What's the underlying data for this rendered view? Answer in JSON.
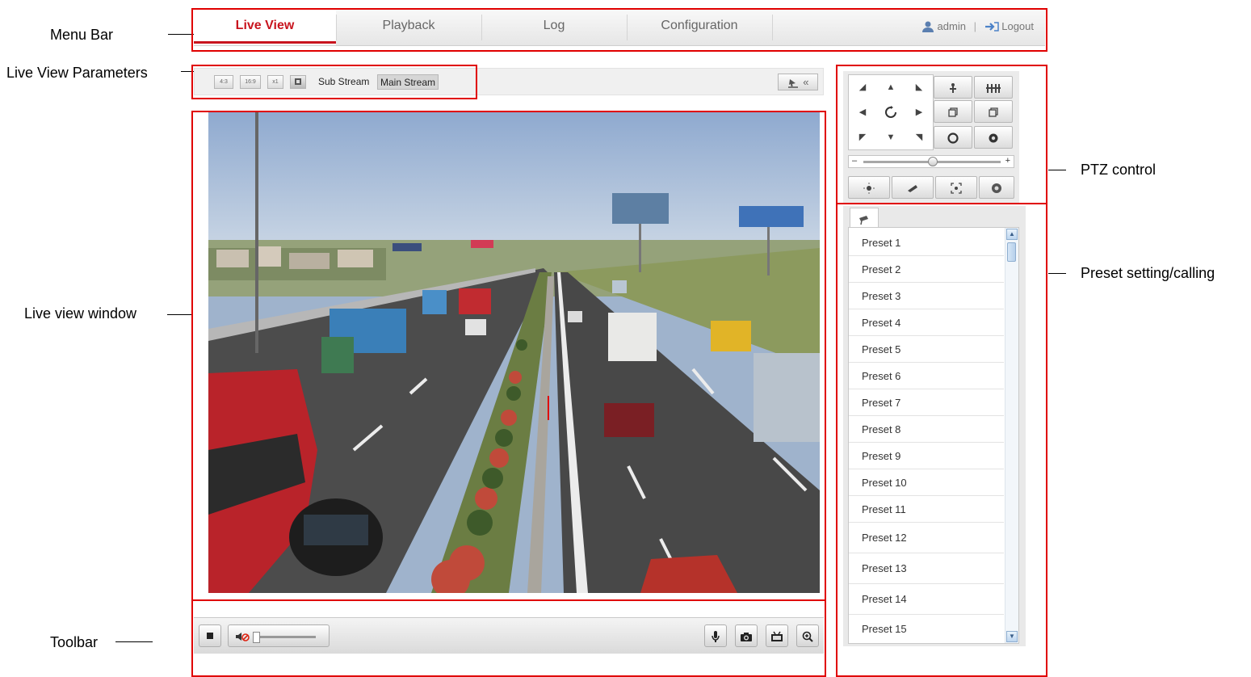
{
  "annotations": {
    "menu_bar": "Menu Bar",
    "live_view_parameters": "Live View Parameters",
    "live_view_window": "Live view window",
    "toolbar": "Toolbar",
    "ptz_control": "PTZ control",
    "preset_setting": "Preset setting/calling"
  },
  "menu": {
    "tabs": [
      "Live View",
      "Playback",
      "Log",
      "Configuration"
    ],
    "active_tab": "Live View",
    "user": "admin",
    "separator": "|",
    "logout": "Logout"
  },
  "params": {
    "sub_stream": "Sub Stream",
    "main_stream": "Main Stream",
    "collapse": "«"
  },
  "presets": {
    "items": [
      "Preset 1",
      "Preset 2",
      "Preset 3",
      "Preset 4",
      "Preset 5",
      "Preset 6",
      "Preset 7",
      "Preset 8",
      "Preset 9",
      "Preset 10",
      "Preset 11",
      "Preset 12",
      "Preset 13",
      "Preset 14",
      "Preset 15"
    ]
  },
  "colors": {
    "accent": "#c8141e",
    "annotation_box": "#e00000"
  }
}
